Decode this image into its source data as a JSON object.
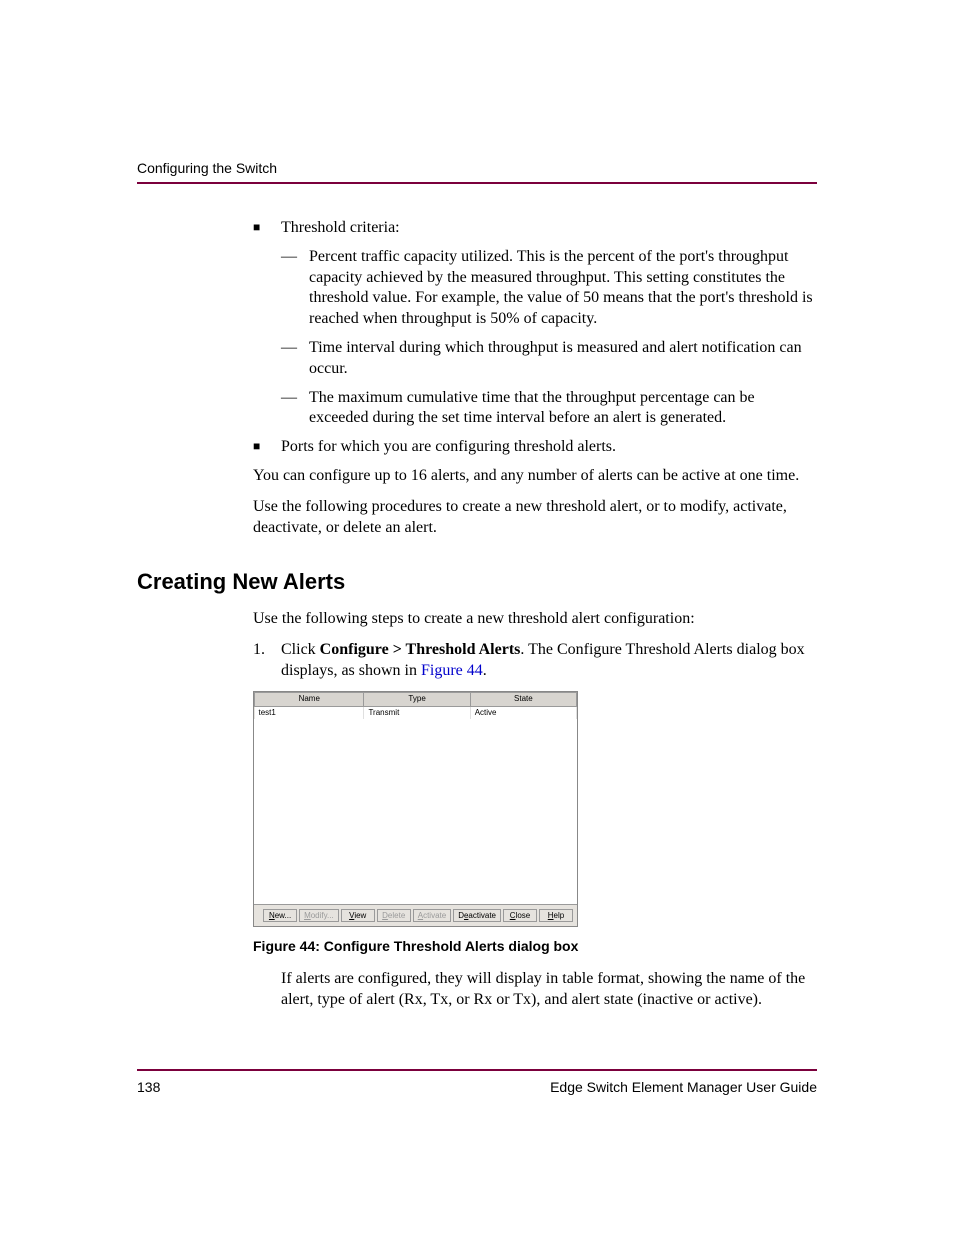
{
  "running_head": "Configuring the Switch",
  "bullet1_intro": "Threshold criteria:",
  "dash1": "Percent traffic capacity utilized. This is the percent of the port's throughput capacity achieved by the measured throughput. This setting constitutes the threshold value. For example, the value of 50 means that the port's threshold is reached when throughput is 50% of capacity.",
  "dash2": "Time interval during which throughput is measured and alert notification can occur.",
  "dash3": "The maximum cumulative time that the throughput percentage can be exceeded during the set time interval before an alert is generated.",
  "bullet2": "Ports for which you are configuring threshold alerts.",
  "para1": "You can configure up to 16 alerts, and any number of alerts can be active at one time.",
  "para2": "Use the following procedures to create a new threshold alert, or to modify, activate, deactivate, or delete an alert.",
  "h2": "Creating New Alerts",
  "para3": "Use the following steps to create a new threshold alert configuration:",
  "step1_num": "1.",
  "step1_a": "Click ",
  "step1_bold": "Configure > Threshold Alerts",
  "step1_b": ". The Configure Threshold Alerts dialog box displays, as shown in ",
  "step1_link": "Figure 44",
  "step1_c": ".",
  "dialog": {
    "columns": {
      "c1": "Name",
      "c2": "Type",
      "c3": "State"
    },
    "row": {
      "name": "test1",
      "type": "Transmit",
      "state": "Active"
    },
    "buttons": {
      "new_pre": "N",
      "new_rest": "ew...",
      "modify_pre": "M",
      "modify_rest": "odify...",
      "view_pre": "V",
      "view_rest": "iew",
      "delete_pre": "D",
      "delete_rest": "elete",
      "activate_pre": "A",
      "activate_rest": "ctivate",
      "deactivate_pre": "",
      "deactivate_mn": "e",
      "deactivate_pre2": "D",
      "deactivate_rest": "activate",
      "close_pre": "C",
      "close_rest": "lose",
      "help_pre": "H",
      "help_rest": "elp"
    }
  },
  "fig_caption": "Figure 44:  Configure Threshold Alerts dialog box",
  "para4": "If alerts are configured, they will display in table format, showing the name of the alert, type of alert (Rx, Tx, or Rx or Tx), and alert state (inactive or active).",
  "footer_page": "138",
  "footer_doc": "Edge Switch Element Manager User Guide"
}
